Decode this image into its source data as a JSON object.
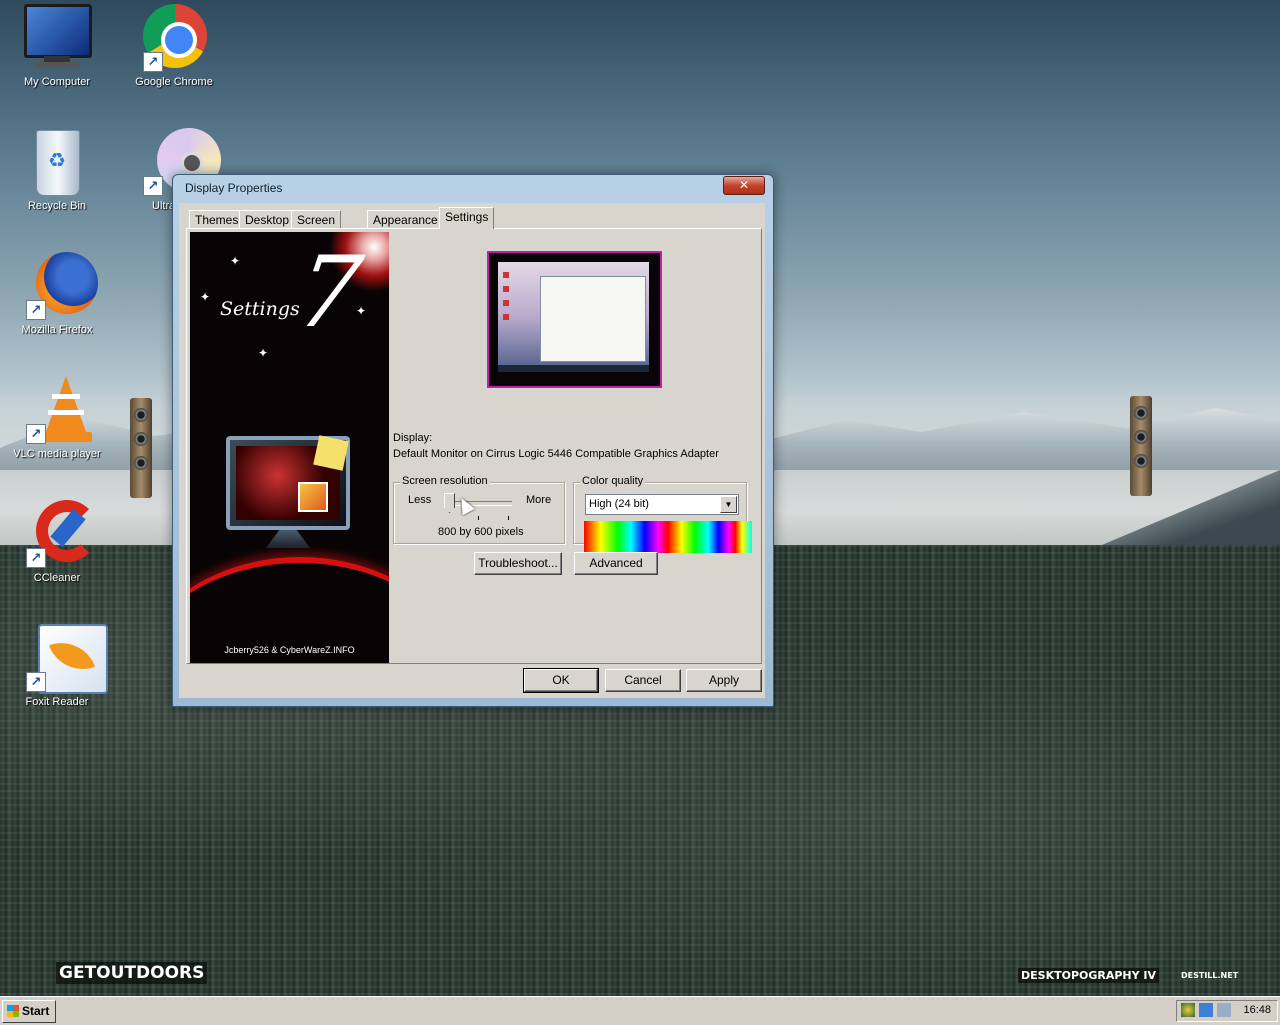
{
  "desktop": {
    "icons": [
      {
        "label": "My Computer"
      },
      {
        "label": "Google Chrome"
      },
      {
        "label": "Recycle Bin"
      },
      {
        "label": "Ultra"
      },
      {
        "label": "Mozilla Firefox"
      },
      {
        "label": "VLC media player"
      },
      {
        "label": "CCleaner"
      },
      {
        "label": "Foxit Reader"
      }
    ],
    "brand_left": "GETOUTDOORS",
    "brand_right": "DESKTOPOGRAPHY IV",
    "brand_right_small": "DESTILL.NET"
  },
  "dialog": {
    "title": "Display Properties",
    "close_glyph": "✕",
    "tabs": [
      {
        "label": "Themes"
      },
      {
        "label": "Desktop"
      },
      {
        "label": "Screen Saver"
      },
      {
        "label": "Appearance"
      },
      {
        "label": "Settings",
        "active": true
      }
    ],
    "sidebar": {
      "title": "Settings",
      "number": "7",
      "credit": "Jcberry526 & CyberWareZ.INFO"
    },
    "display_label": "Display:",
    "display_value": "Default Monitor on Cirrus Logic 5446 Compatible Graphics Adapter",
    "screen_resolution": {
      "legend": "Screen resolution",
      "less_label": "Less",
      "more_label": "More",
      "value_text": "800 by 600 pixels",
      "slider_position": 0.0
    },
    "color_quality": {
      "legend": "Color quality",
      "selected": "High (24 bit)",
      "arrow": "▼"
    },
    "buttons": {
      "troubleshoot": "Troubleshoot...",
      "advanced": "Advanced",
      "ok": "OK",
      "cancel": "Cancel",
      "apply": "Apply"
    }
  },
  "taskbar": {
    "start_label": "Start",
    "clock": "16:48"
  },
  "colors": {
    "titlebar": "#9dbad4",
    "dialog_face": "#d8d5ce",
    "close_button": "#c2432b",
    "preview_border": "#c01fae",
    "sidebar_accent": "#d41010"
  }
}
